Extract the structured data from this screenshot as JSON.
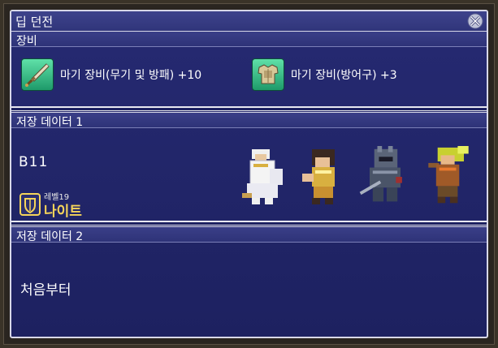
{
  "window": {
    "title": "딥 던전"
  },
  "equipment": {
    "header": "장비",
    "items": [
      {
        "label": "마기 장비(무기 및 방패) +10",
        "icon": "sword-icon"
      },
      {
        "label": "마기 장비(방어구) +3",
        "icon": "armor-icon"
      }
    ]
  },
  "save1": {
    "header": "저장 데이터 1",
    "floor": "B11",
    "level_label": "레벨19",
    "job": "나이트",
    "party": [
      "white-mage-sprite",
      "monk-sprite",
      "dark-knight-sprite",
      "thief-sprite"
    ]
  },
  "save2": {
    "header": "저장 데이터 2",
    "action": "처음부터"
  },
  "colors": {
    "panel": "#262a72",
    "accent_gold": "#f5d45a",
    "icon_green": "#3cc48a"
  }
}
